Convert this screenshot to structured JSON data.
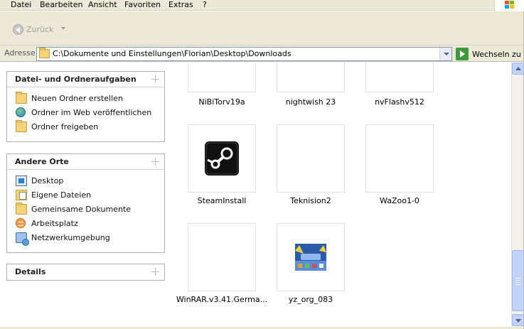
{
  "menu": {
    "items": [
      "Datei",
      "Bearbeiten",
      "Ansicht",
      "Favoriten",
      "Extras",
      "?"
    ]
  },
  "toolbar": {
    "back_label": "Zurück"
  },
  "address": {
    "label": "Adresse",
    "path": "C:\\Dokumente und Einstellungen\\Florian\\Desktop\\Downloads",
    "go_label": "Wechseln zu"
  },
  "tasks": {
    "title": "Datei- und Ordneraufgaben",
    "items": [
      {
        "label": "Neuen Ordner erstellen",
        "icon": "new-folder-icon"
      },
      {
        "label": "Ordner im Web veröffentlichen",
        "icon": "web-publish-icon"
      },
      {
        "label": "Ordner freigeben",
        "icon": "share-folder-icon"
      }
    ]
  },
  "places": {
    "title": "Andere Orte",
    "items": [
      {
        "label": "Desktop",
        "icon": "desktop-icon"
      },
      {
        "label": "Eigene Dateien",
        "icon": "my-documents-icon"
      },
      {
        "label": "Gemeinsame Dokumente",
        "icon": "shared-documents-icon"
      },
      {
        "label": "Arbeitsplatz",
        "icon": "my-computer-icon"
      },
      {
        "label": "Netzwerkumgebung",
        "icon": "network-icon"
      }
    ]
  },
  "details": {
    "title": "Details"
  },
  "files": [
    {
      "name": "NiBiTorv19a"
    },
    {
      "name": "nightwish 23"
    },
    {
      "name": "nvFlashv512"
    },
    {
      "name": "SteamInstall"
    },
    {
      "name": "Teknision2"
    },
    {
      "name": "WaZoo1-0"
    },
    {
      "name": "WinRAR.v3.41.Germa..."
    },
    {
      "name": "yz_org_083"
    }
  ],
  "colors": {
    "chrome": "#ece9d8",
    "scrollbar": "#c1d3fb",
    "go_green": "#3c9a3c"
  }
}
